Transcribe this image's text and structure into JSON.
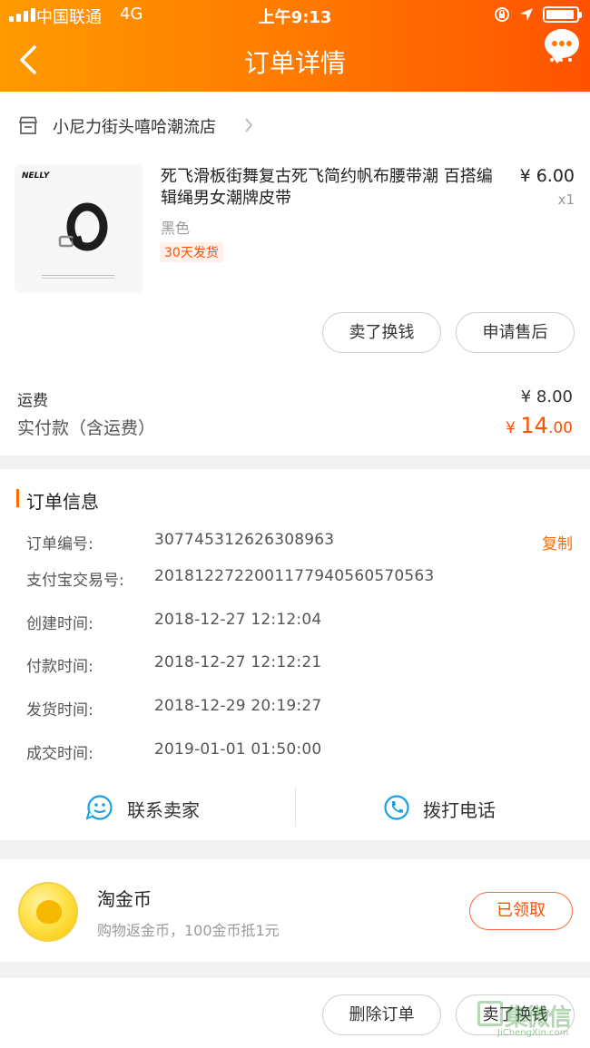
{
  "status_bar": {
    "carrier": "中国联通",
    "network": "4G",
    "time": "上午9:13"
  },
  "nav": {
    "title": "订单详情"
  },
  "shop": {
    "name": "小尼力街头嘻哈潮流店"
  },
  "product": {
    "brand_text": "NELLY",
    "name": "死飞滑板街舞复古死飞简约帆布腰带潮 百搭编辑绳男女潮牌皮带",
    "price": "¥ 6.00",
    "quantity": "x1",
    "sku": "黑色",
    "ship_badge": "30天发货"
  },
  "product_actions": {
    "sell": "卖了换钱",
    "after_sale": "申请售后"
  },
  "totals": {
    "shipping_label": "运费",
    "shipping_value": "¥ 8.00",
    "paid_label": "实付款（含运费）",
    "paid_currency": "¥ ",
    "paid_int": "14",
    "paid_dec": ".00"
  },
  "order_info": {
    "title": "订单信息",
    "copy_label": "复制",
    "rows": [
      {
        "label": "订单编号:",
        "value": "307745312626308963"
      },
      {
        "label": "支付宝交易号:",
        "value": "2018122722001177940560570563"
      },
      {
        "label": "创建时间:",
        "value": "2018-12-27 12:12:04"
      },
      {
        "label": "付款时间:",
        "value": "2018-12-27 12:12:21"
      },
      {
        "label": "发货时间:",
        "value": "2018-12-29 20:19:27"
      },
      {
        "label": "成交时间:",
        "value": "2019-01-01 01:50:00"
      }
    ],
    "contact_seller": "联系卖家",
    "call_phone": "拨打电话"
  },
  "coins": {
    "title": "淘金币",
    "subtitle": "购物返金币，100金币抵1元",
    "button": "已领取"
  },
  "bottom_actions": {
    "delete": "删除订单",
    "sell": "卖了换钱"
  },
  "watermark": {
    "text": "集微信",
    "url": "JiChengXin.com"
  },
  "colors": {
    "accent": "#ff6a00",
    "price": "#ff5000",
    "header_start": "#ff9a00",
    "header_end": "#ff5200"
  }
}
